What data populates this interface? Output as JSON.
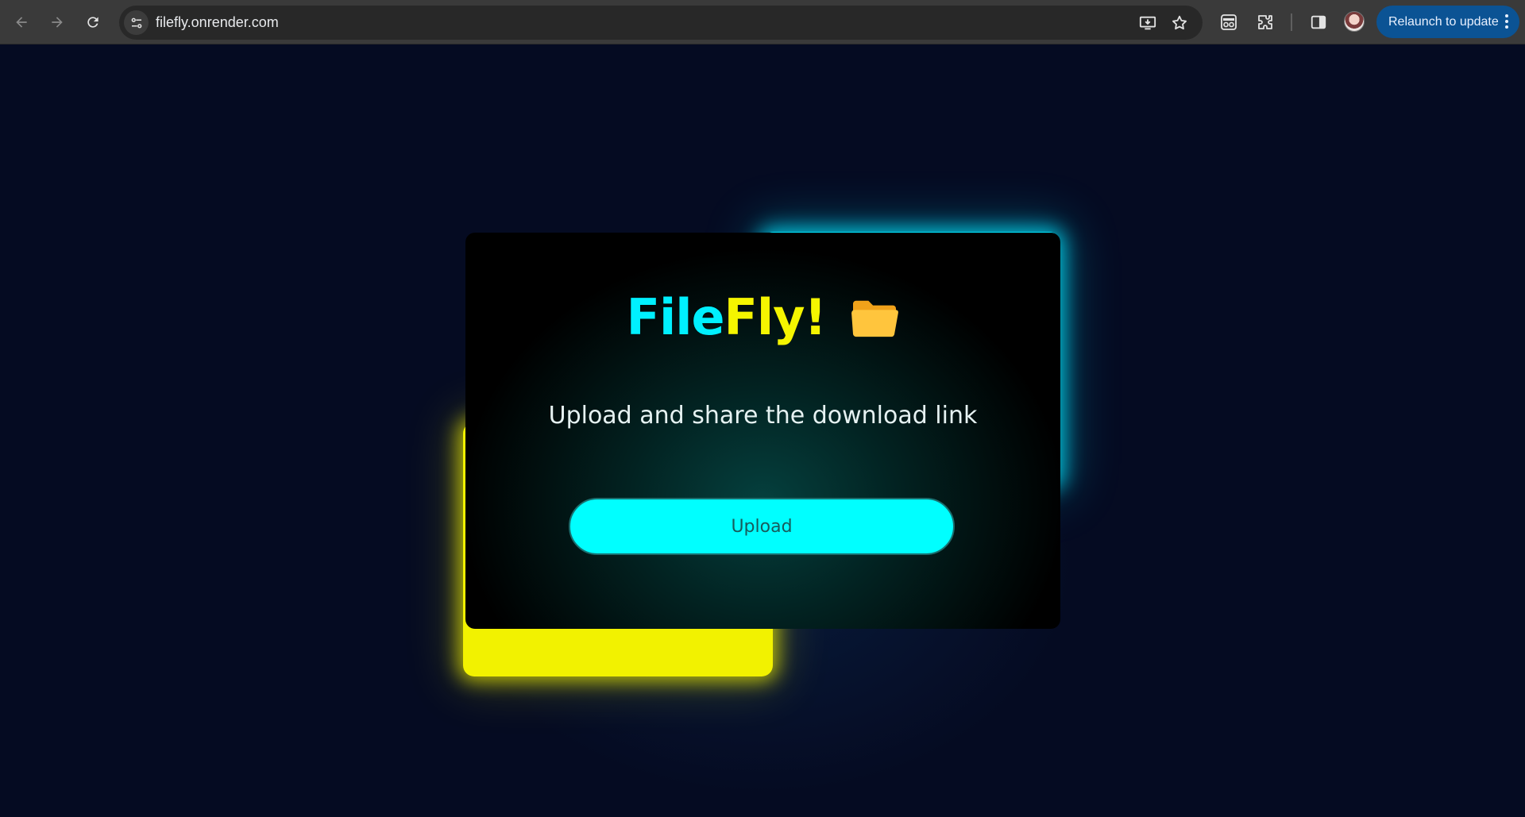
{
  "browser": {
    "url": "filefly.onrender.com",
    "relaunch_label": "Relaunch to update",
    "icons": [
      "back-arrow-icon",
      "forward-arrow-icon",
      "reload-icon",
      "site-info-icon",
      "install-app-icon",
      "bookmark-star-icon",
      "incognito-glasses-icon",
      "extensions-puzzle-icon",
      "side-panel-icon",
      "profile-avatar",
      "more-menu-icon"
    ]
  },
  "app": {
    "brand_part1": "File",
    "brand_part2": "Fly!",
    "brand_icon": "folder-icon",
    "tagline": "Upload and share the download link",
    "upload_label": "Upload",
    "colors": {
      "cyan": "#00ffff",
      "yellow": "#f5f500",
      "background": "#050b22"
    }
  }
}
